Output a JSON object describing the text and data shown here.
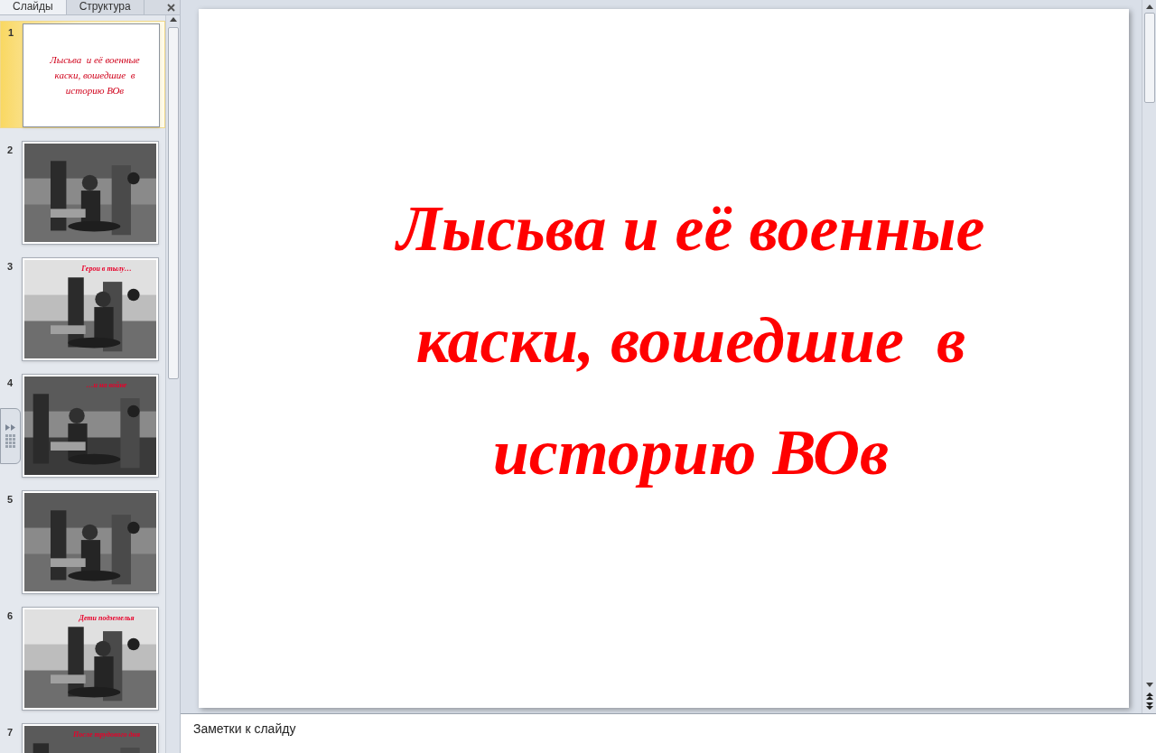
{
  "panel_tabs": [
    {
      "label": "Слайды",
      "selected": true
    },
    {
      "label": "Структура",
      "selected": false
    }
  ],
  "slides": [
    {
      "number": "1",
      "selected": true,
      "kind": "title",
      "lines": [
        "Лысьва  и её военные",
        "каски, вошедшие  в",
        "историю ВОв"
      ]
    },
    {
      "number": "2",
      "selected": false
    },
    {
      "number": "3",
      "selected": false,
      "caption": "Герои в тылу…"
    },
    {
      "number": "4",
      "selected": false,
      "caption": "…и на войне"
    },
    {
      "number": "5",
      "selected": false
    },
    {
      "number": "6",
      "selected": false,
      "caption": "Дети подземелья"
    },
    {
      "number": "7",
      "selected": false,
      "caption": "После трудового дня"
    }
  ],
  "slide_title": [
    "Лысьва и её военные",
    "каски, вошедшие  в",
    "историю ВОв"
  ],
  "notes": {
    "placeholder": "Заметки к слайду"
  }
}
